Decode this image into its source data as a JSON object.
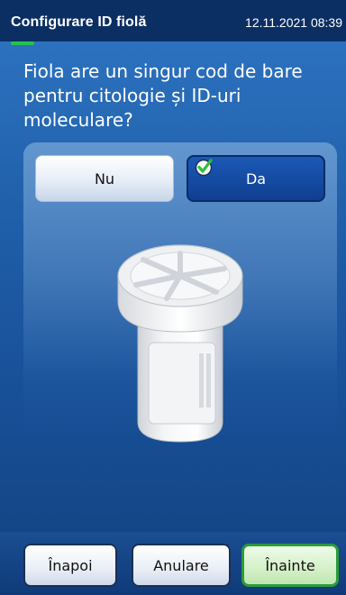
{
  "header": {
    "title": "Configurare ID fiolă",
    "datetime": "12.11.2021 08:39"
  },
  "question": "Fiola are un singur cod de bare pentru citologie și ID-uri moleculare?",
  "choices": {
    "no_label": "Nu",
    "yes_label": "Da",
    "selected": "Da"
  },
  "footer": {
    "back_label": "Înapoi",
    "cancel_label": "Anulare",
    "next_label": "Înainte"
  },
  "colors": {
    "header_bg": "#0c2f63",
    "selected_choice": "#0f3f90",
    "next_border": "#2a9c3a",
    "progress": "#27c24a"
  },
  "icons": [
    "check-icon",
    "vial-icon"
  ]
}
